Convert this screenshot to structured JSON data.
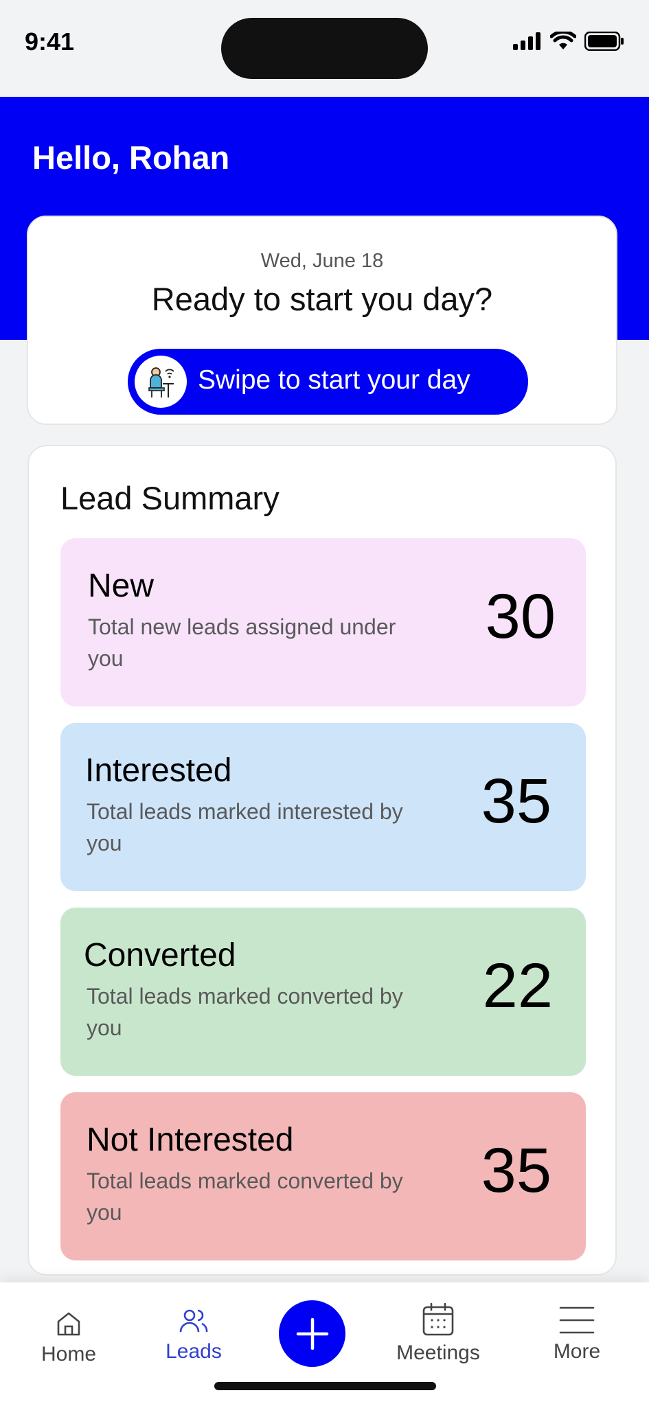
{
  "status_bar": {
    "time": "9:41"
  },
  "header": {
    "greeting": "Hello, Rohan"
  },
  "day_card": {
    "date": "Wed, June 18",
    "prompt": "Ready to start you day?",
    "swipe_label": "Swipe to start your day",
    "swipe_icon": "person-at-desk-icon"
  },
  "lead_summary": {
    "title": "Lead Summary",
    "items": [
      {
        "name": "New",
        "description": "Total new leads assigned under you",
        "count": "30",
        "color": "#f8e3fb"
      },
      {
        "name": "Interested",
        "description": "Total leads marked interested by you",
        "count": "35",
        "color": "#cde4f9"
      },
      {
        "name": "Converted",
        "description": "Total leads marked converted by you",
        "count": "22",
        "color": "#c8e6cc"
      },
      {
        "name": "Not Interested",
        "description": "Total leads marked converted by you",
        "count": "35",
        "color": "#f3b7b8"
      }
    ]
  },
  "tabbar": {
    "tabs": [
      {
        "label": "Home",
        "icon": "home-icon"
      },
      {
        "label": "Leads",
        "icon": "users-icon",
        "active": true
      },
      {
        "label": "Meetings",
        "icon": "calendar-icon"
      },
      {
        "label": "More",
        "icon": "menu-icon"
      }
    ],
    "fab_icon": "plus-icon"
  },
  "colors": {
    "primary": "#0000f5",
    "active_tab": "#2f3fd0"
  }
}
